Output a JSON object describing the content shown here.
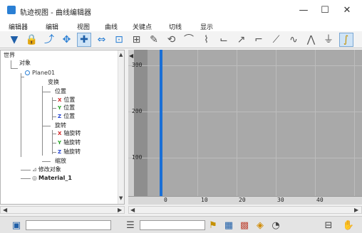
{
  "window": {
    "title": "轨迹视图 - 曲线编辑器",
    "minimize": "—",
    "maximize": "☐",
    "close": "✕"
  },
  "menu": [
    "编辑器",
    "编辑",
    "视图",
    "曲线",
    "关键点",
    "切线",
    "显示"
  ],
  "toolbar": [
    {
      "name": "filters-icon",
      "glyph": "▼",
      "color": "#1f5fa8"
    },
    {
      "name": "lock-icon",
      "glyph": "🔒",
      "color": "#c59100"
    },
    {
      "name": "snap-icon",
      "glyph": "⤴",
      "color": "#2a7fd4"
    },
    {
      "name": "move-keys-icon",
      "glyph": "✥",
      "color": "#2a7fd4",
      "active": false
    },
    {
      "name": "move-keys-vertical-icon",
      "glyph": "✚",
      "color": "#1f5fa8",
      "active": true
    },
    {
      "name": "slide-keys-icon",
      "glyph": "⇔",
      "color": "#2a7fd4"
    },
    {
      "name": "scale-keys-icon",
      "glyph": "⊡",
      "color": "#2a7fd4"
    },
    {
      "name": "scale-values-icon",
      "glyph": "⊞",
      "color": "#555555"
    },
    {
      "name": "draw-curves-icon",
      "glyph": "✎",
      "color": "#555555"
    },
    {
      "name": "reduce-keys-icon",
      "glyph": "⟲",
      "color": "#555555"
    },
    {
      "name": "tangent-auto-icon",
      "glyph": "⌒",
      "color": "#555555"
    },
    {
      "name": "tangent-custom-icon",
      "glyph": "⌇",
      "color": "#555555"
    },
    {
      "name": "tangent-fast-icon",
      "glyph": "⌙",
      "color": "#555555"
    },
    {
      "name": "tangent-slow-icon",
      "glyph": "↗",
      "color": "#555555"
    },
    {
      "name": "tangent-step-icon",
      "glyph": "⌐",
      "color": "#555555"
    },
    {
      "name": "tangent-linear-icon",
      "glyph": "⟋",
      "color": "#555555"
    },
    {
      "name": "tangent-smooth-icon",
      "glyph": "∿",
      "color": "#555555"
    },
    {
      "name": "break-tangents-icon",
      "glyph": "⋀",
      "color": "#555555"
    },
    {
      "name": "unify-tangents-icon",
      "glyph": "⏚",
      "color": "#555555"
    },
    {
      "name": "show-tangents-icon",
      "glyph": "∫",
      "color": "#c59100",
      "active": true
    }
  ],
  "tree": {
    "world": "世界",
    "objects": "对象",
    "plane": "Plane01",
    "transform": "变换",
    "position": "位置",
    "position_x": "位置",
    "position_y": "位置",
    "position_z": "位置",
    "rotation": "旋转",
    "rotation_x": "轴旋转",
    "rotation_y": "轴旋转",
    "rotation_z": "轴旋转",
    "scale": "缩放",
    "modified_object": "修改对象",
    "material": "Material_1",
    "axes": [
      "X",
      "Y",
      "Z"
    ],
    "axis_colors": [
      "#d02020",
      "#20a020",
      "#2040d0"
    ]
  },
  "graph": {
    "y_labels": [
      "300",
      "200",
      "100"
    ],
    "x_labels": [
      "0",
      "10",
      "20",
      "30",
      "40"
    ],
    "time_slider_color": "#1a6fd6",
    "background": "#a9a9a9",
    "left_band": "#8e8e8e"
  },
  "statusbar": {
    "field_left": "",
    "field_right": ""
  }
}
